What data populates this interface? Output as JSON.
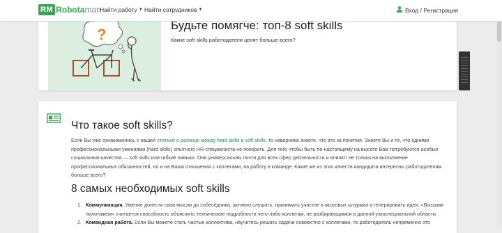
{
  "header": {
    "logo_badge": "RM",
    "logo_part1": "Robota",
    "logo_part2": "man",
    "nav": [
      {
        "label": "Найти работу"
      },
      {
        "label": "Найти сотрудников"
      }
    ],
    "login_label": "Вход / Регистрация"
  },
  "hero": {
    "title": "Будьте помягче: топ-8 soft skills",
    "subtitle": "Какие soft skills работодатели ценят больше всего?",
    "image_question_mark": "?"
  },
  "article": {
    "h1": "Что такое soft skills?",
    "para": {
      "t1": "Если Вы уже ознакомились с нашей ",
      "link1": "статьей о разнице между hard skills и soft skills",
      "t2": ", то наверняка знаете, что это за понятия. Знаете Вы и то, что одними профессиональными умениями (hard skills) опытного HR-специалиста не покорить. Для того чтобы быть по-настоящему на высоте Вам потребуются особые социальные качества — soft skills или гибкие навыки. Они универсальны почти для всех сфер деятельности и влияют не только на выполнение профессиональных обязанностей, но и на Ваши отношения с коллегами, на работу в команде. Какие же из этих качеств кандидата интересны работодателям больше всего?"
    },
    "h2": "8 самых необходимых soft skills",
    "list": [
      {
        "num": "1.",
        "term": "Коммуникация.",
        "text": " Умение донести свои мысли до собеседника, активно слушать, принимать участие в мозговых штурмах и генерировать идеи. «Высшим пилотажем» считается способность объяснить технические подробности чего-либо коллегам, не разбирающимся в данной узкоспециальной области."
      },
      {
        "num": "2.",
        "term": "Командная работа.",
        "text": " Если Вы можете стать частью коллектива, научитесь решать задачи совместно с коллегами, то работодатель непременно это"
      }
    ]
  },
  "colors": {
    "brand_green": "#3aa655",
    "link_green": "#2e8b4a",
    "background": "#ececec"
  }
}
